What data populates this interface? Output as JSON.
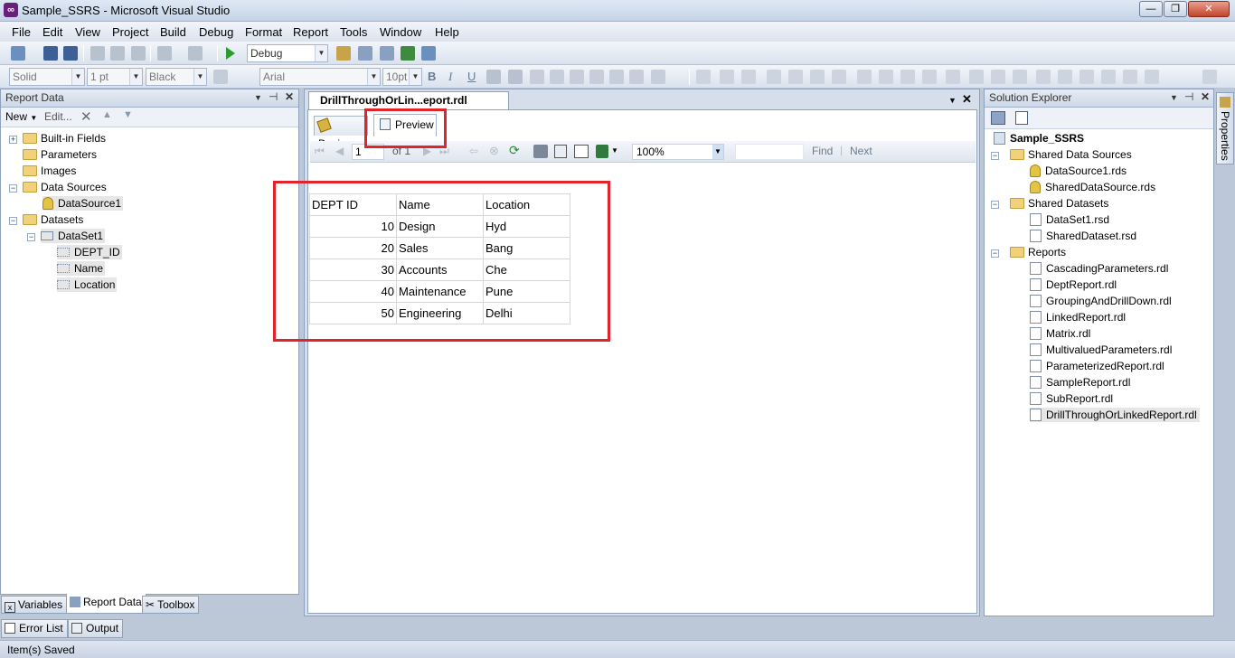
{
  "window": {
    "title": "Sample_SSRS - Microsoft Visual Studio",
    "controls": [
      "—",
      "❐",
      "✕"
    ]
  },
  "menu": [
    "File",
    "Edit",
    "View",
    "Project",
    "Build",
    "Debug",
    "Format",
    "Report",
    "Tools",
    "Window",
    "Help"
  ],
  "toolbar1": {
    "config": "Debug"
  },
  "toolbar2": {
    "border_style": "Solid",
    "border_width": "1 pt",
    "color": "Black",
    "font": "Arial",
    "font_size": "10pt",
    "bold": "B",
    "italic": "I",
    "underline": "U"
  },
  "report_data": {
    "title": "Report Data",
    "new_label": "New",
    "edit_label": "Edit...",
    "tree": {
      "builtin": "Built-in Fields",
      "parameters": "Parameters",
      "images": "Images",
      "data_sources": "Data Sources",
      "datasource1": "DataSource1",
      "datasets": "Datasets",
      "dataset1": "DataSet1",
      "fields": [
        "DEPT_ID",
        "Name",
        "Location"
      ]
    },
    "bottom_tabs": [
      "Variables",
      "Report Data",
      "Toolbox"
    ]
  },
  "document": {
    "tab_title": "DrillThroughOrLin...eport.rdl [Design]",
    "design_tab": "Design",
    "preview_tab": "Preview",
    "page_current": "1",
    "page_of": "of  1",
    "zoom": "100%",
    "find": "Find",
    "next": "Next"
  },
  "report_table": {
    "headers": [
      "DEPT ID",
      "Name",
      "Location"
    ],
    "rows": [
      [
        "10",
        "Design",
        "Hyd"
      ],
      [
        "20",
        "Sales",
        "Bang"
      ],
      [
        "30",
        "Accounts",
        "Che"
      ],
      [
        "40",
        "Maintenance",
        "Pune"
      ],
      [
        "50",
        "Engineering",
        "Delhi"
      ]
    ]
  },
  "solution_explorer": {
    "title": "Solution Explorer",
    "project": "Sample_SSRS",
    "shared_data_sources": "Shared Data Sources",
    "sds_files": [
      "DataSource1.rds",
      "SharedDataSource.rds"
    ],
    "shared_datasets": "Shared Datasets",
    "sdset_files": [
      "DataSet1.rsd",
      "SharedDataset.rsd"
    ],
    "reports": "Reports",
    "report_files": [
      "CascadingParameters.rdl",
      "DeptReport.rdl",
      "GroupingAndDrillDown.rdl",
      "LinkedReport.rdl",
      "Matrix.rdl",
      "MultivaluedParameters.rdl",
      "ParameterizedReport.rdl",
      "SampleReport.rdl",
      "SubReport.rdl",
      "DrillThroughOrLinkedReport.rdl"
    ]
  },
  "properties_tab": "Properties",
  "output_tabs": [
    "Error List",
    "Output"
  ],
  "status": "Item(s) Saved",
  "colors": {
    "highlight": "#e0242b",
    "accent": "#68217a"
  }
}
